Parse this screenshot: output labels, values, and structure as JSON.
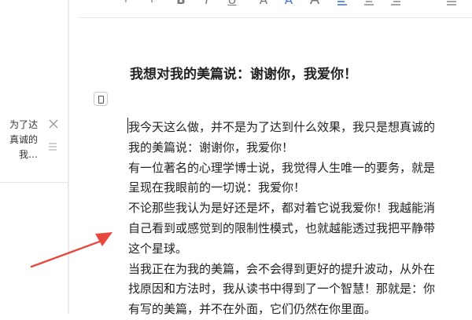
{
  "sidebar": {
    "note_lines": [
      "为了达",
      "真诚的",
      "我…"
    ]
  },
  "document": {
    "title": "我想对我的美篇说：谢谢你，我爱你！",
    "lines": [
      "我今天这么做，并不是为了达到什么效果，我只是想真诚的",
      "我的美篇说：谢谢你，我爱你！",
      "有一位著名的心理学博士说，我觉得人生唯一的要务，就是",
      "呈现在我眼前的一切说：我爱你！",
      "不论那些我认为是好还是坏，都对着它说我爱你！我越能消",
      "自己看到或感觉到的限制性模式，也就越能透过我把平静带",
      "这个星球。",
      "当我正在为我的美篇，会不会得到更好的提升波动，从外在",
      "找原因和方法时，我从读书中得到了一个智慧！那就是：你",
      "有写的美篇，并不在外面，它们仍然在你里面。"
    ]
  },
  "toolbar": {
    "icons": [
      "undo-icon",
      "redo-icon",
      "bold-icon",
      "italic-icon",
      "underline-icon",
      "font-color-icon",
      "highlight-icon",
      "font-size-icon",
      "align-left-icon",
      "align-center-icon",
      "align-right-icon",
      "list-icon"
    ]
  },
  "colors": {
    "accent": "#3a6fd8",
    "arrow": "#e8473e",
    "sidebar_bg": "#eceff2"
  }
}
